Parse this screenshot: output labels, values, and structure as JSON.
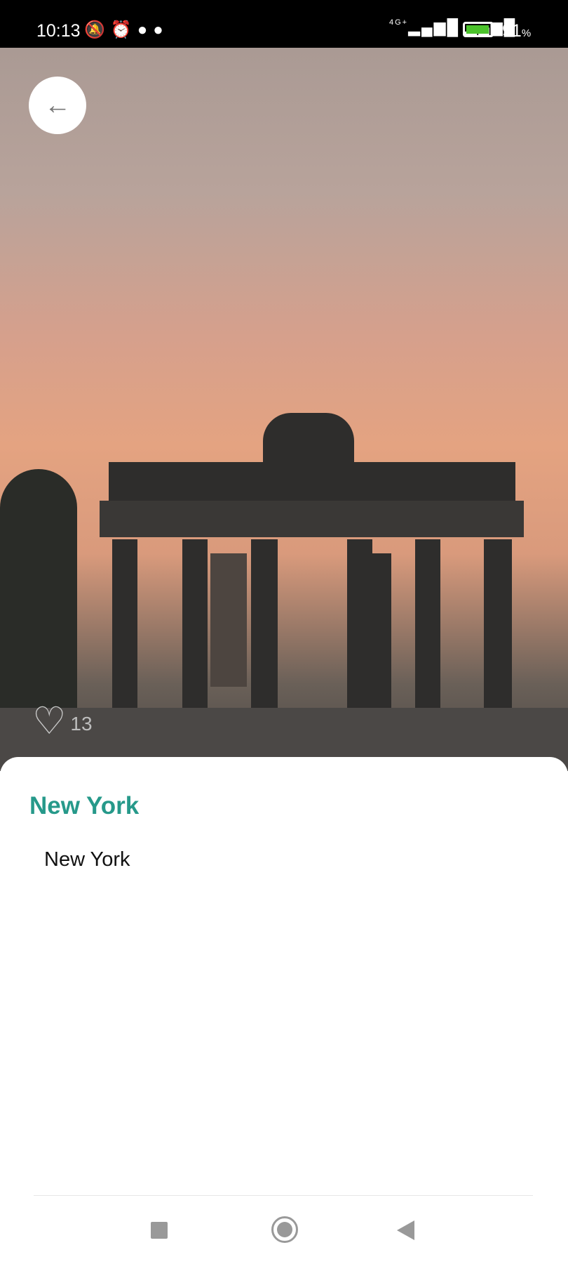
{
  "status_bar": {
    "time": "10:13",
    "network": "4G+",
    "battery": "91",
    "battery_unit": "%"
  },
  "hero": {
    "like_count": "13",
    "back_icon": "arrow-left-icon",
    "like_icon": "heart-outline-icon"
  },
  "content": {
    "title": "New York",
    "description": "New York"
  },
  "colors": {
    "accent": "#26998a",
    "battery": "#4cc32c"
  },
  "nav_bar": {
    "buttons": [
      "recents",
      "home",
      "back"
    ]
  }
}
